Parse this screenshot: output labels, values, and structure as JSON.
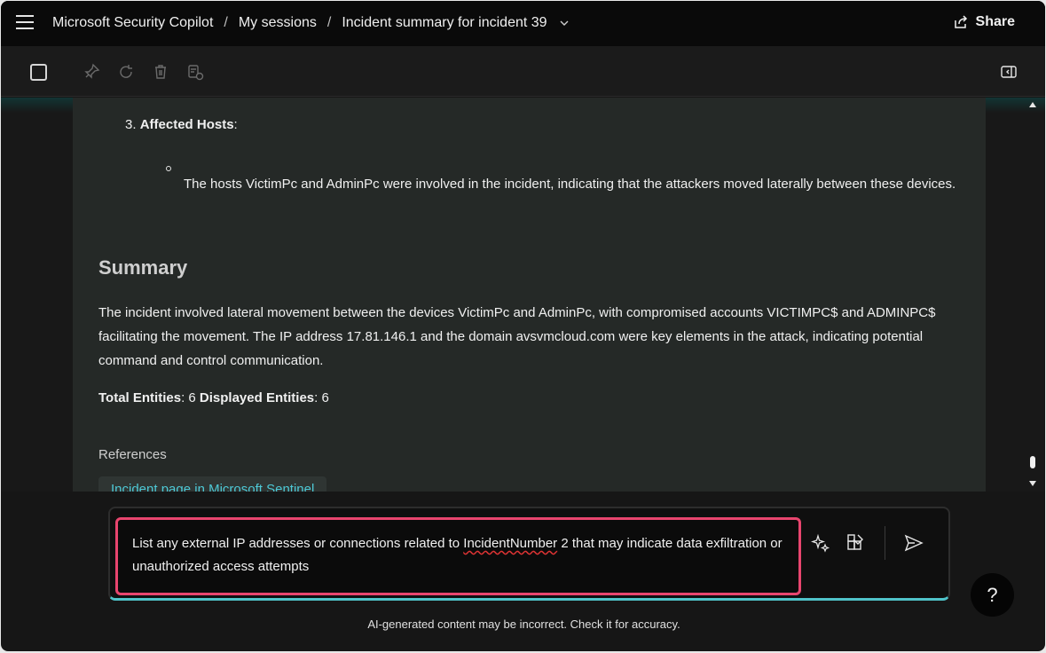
{
  "header": {
    "app_title": "Microsoft Security Copilot",
    "crumb_sessions": "My sessions",
    "crumb_current": "Incident summary for incident 39",
    "sep": "/",
    "share_label": "Share"
  },
  "content": {
    "item_number": "3.",
    "item_title": "Affected Hosts",
    "item_colon": ":",
    "bullet_text": "The hosts VictimPc and AdminPc were involved in the incident, indicating that the attackers moved laterally between these devices.",
    "summary_title": "Summary",
    "summary_text": "The incident involved lateral movement between the devices VictimPc and AdminPc, with compromised accounts VICTIMPC$ and ADMINPC$ facilitating the movement. The IP address 17.81.146.1 and the domain avsvmcloud.com were key elements in the attack, indicating potential command and control communication.",
    "total_label": "Total Entities",
    "total_value": ": 6 ",
    "displayed_label": "Displayed Entities",
    "displayed_value": ": 6",
    "references_label": "References",
    "reference_link": "Incident page in Microsoft Sentinel"
  },
  "input": {
    "text_before": "List any external IP addresses or connections related to ",
    "text_squiggle": "IncidentNumber",
    "text_after": " 2 that may indicate data exfiltration or unauthorized access attempts"
  },
  "footer": {
    "disclaimer": "AI-generated content may be incorrect. Check it for accuracy.",
    "help_label": "?"
  },
  "colors": {
    "accent_teal": "#4fc3c9",
    "prompt_highlight": "#e8456e",
    "link": "#4ec9d6"
  }
}
